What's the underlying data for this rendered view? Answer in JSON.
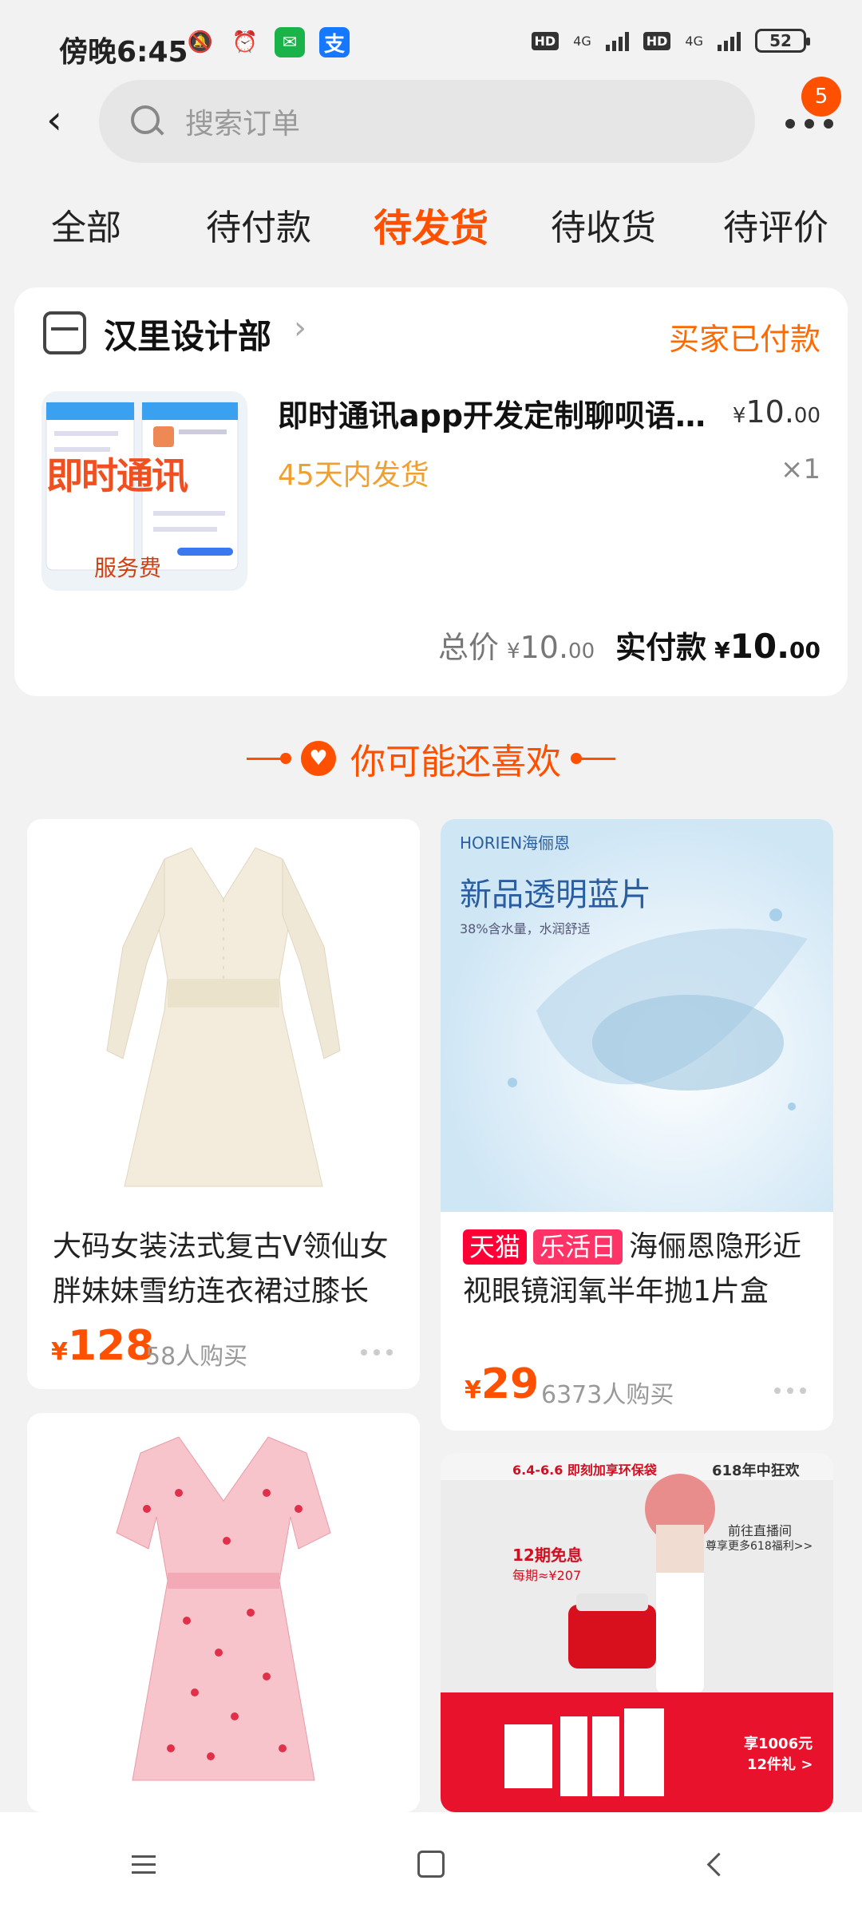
{
  "status_bar": {
    "time": "傍晚6:45",
    "hd1": "HD",
    "net1": "4G",
    "hd2": "HD",
    "net2": "4G",
    "battery": "52",
    "icons": [
      "bell-off-icon",
      "alarm-icon",
      "wechat-icon",
      "alipay-icon"
    ]
  },
  "header": {
    "search_placeholder": "搜索订单",
    "message_badge": "5"
  },
  "tabs": [
    {
      "label": "全部",
      "active": false
    },
    {
      "label": "待付款",
      "active": false
    },
    {
      "label": "待发货",
      "active": true
    },
    {
      "label": "待收货",
      "active": false
    },
    {
      "label": "待评价",
      "active": false
    }
  ],
  "order": {
    "shop_name": "汉里设计部",
    "status": "买家已付款",
    "product_title": "即时通讯app开发定制聊呗语音系统",
    "price_symbol": "¥",
    "price_int": "10.",
    "price_dec": "00",
    "ship_note": "45天内发货",
    "quantity": "×1",
    "image_caption_main": "即时通讯",
    "image_caption_sub": "服务费",
    "total_label": "总价",
    "total_int": "10.",
    "total_dec": "00",
    "paid_label": "实付款",
    "paid_int": "10.",
    "paid_dec": "00"
  },
  "recommend": {
    "title": "你可能还喜欢",
    "items": [
      {
        "title_line1": "大码女装法式复古V领仙女",
        "title_line2": "胖妹妹雪纺连衣裙过膝长",
        "price_symbol": "¥",
        "price": "128",
        "sold": "58人购买"
      },
      {
        "tags": [
          "天猫",
          "乐活日"
        ],
        "title_line1": "海俪恩隐形近",
        "title_line2": "视眼镜润氧半年抛1片盒",
        "price_symbol": "¥",
        "price": "29",
        "sold": "6373人购买",
        "image_brand": "HORIEN海俪恩",
        "image_headline": "新品透明蓝片",
        "image_sub": "38%含水量，水润舒适"
      },
      {
        "image_desc": "pink floral dress"
      },
      {
        "image_banner_left": "6.4-6.6 即刻加享环保袋",
        "image_banner_right": "618年中狂欢",
        "image_promo": "12期免息",
        "image_promo_sub": "每期≈¥207",
        "image_cta": "前往直播间",
        "image_cta_sub": "尊享更多618福利>>",
        "image_bottom": "享1006元",
        "image_bottom_sub": "12件礼 >"
      }
    ]
  },
  "colors": {
    "accent": "#ff5000",
    "ship_note": "#f0a030",
    "background": "#f2f2f2"
  }
}
